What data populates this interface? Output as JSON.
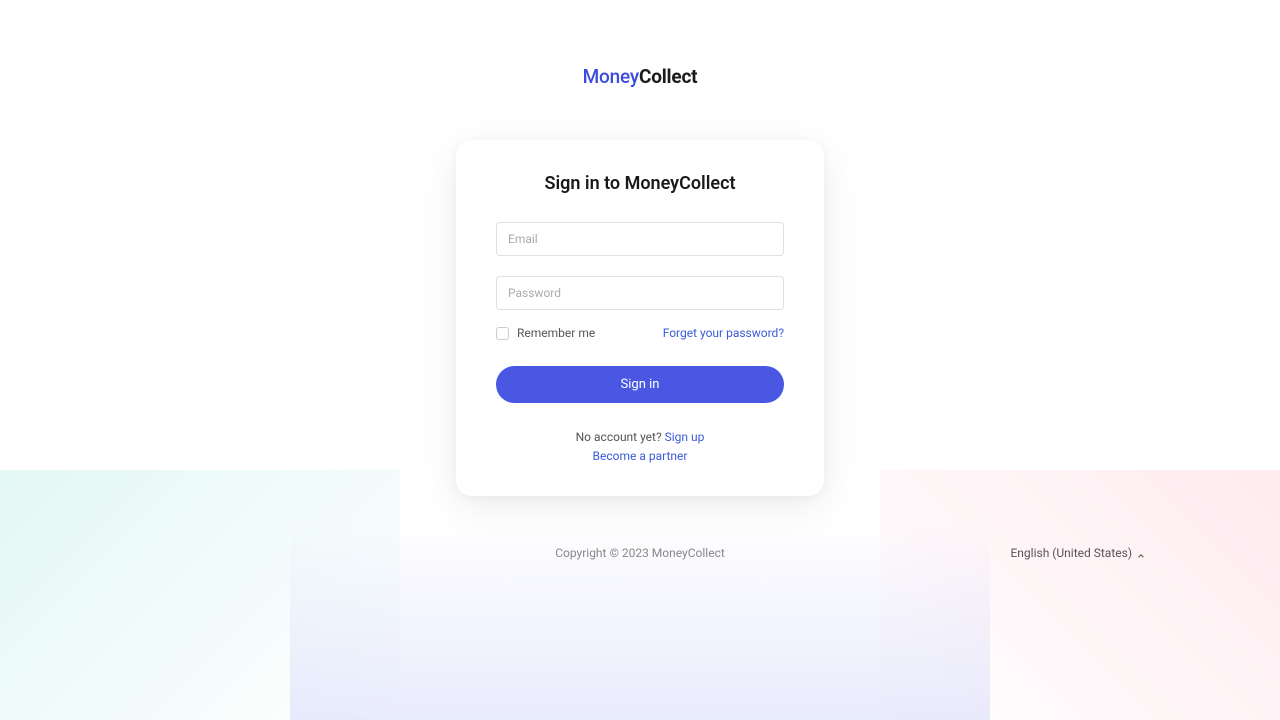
{
  "logo": {
    "part1": "Money",
    "part2": "Collect"
  },
  "card": {
    "title": "Sign in to MoneyCollect",
    "email_placeholder": "Email",
    "password_placeholder": "Password",
    "remember_label": "Remember me",
    "forgot_link": "Forget your password?",
    "signin_button": "Sign in",
    "no_account_text": "No account yet? ",
    "signup_link": "Sign up",
    "partner_link": "Become a partner"
  },
  "footer": {
    "copyright": "Copyright © 2023 MoneyCollect",
    "language": "English (United States)"
  }
}
